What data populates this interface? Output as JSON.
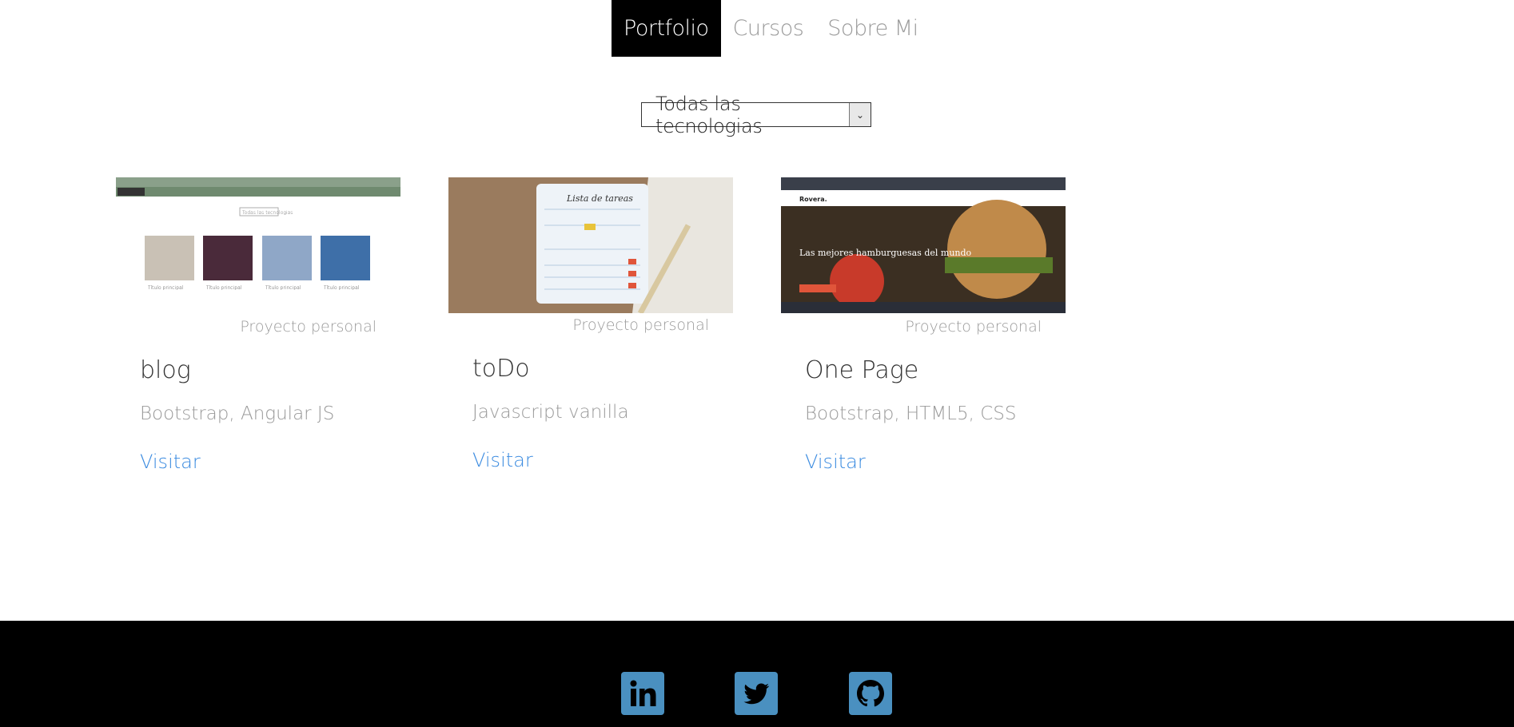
{
  "nav": {
    "items": [
      {
        "label": "Portfolio",
        "active": true
      },
      {
        "label": "Cursos",
        "active": false
      },
      {
        "label": "Sobre Mi",
        "active": false
      }
    ]
  },
  "filter": {
    "selected": "Todas las tecnologias"
  },
  "projects": [
    {
      "tag": "Proyecto personal",
      "title": "blog",
      "tech": "Bootstrap, Angular JS",
      "link": "Visitar"
    },
    {
      "tag": "Proyecto personal",
      "title": "toDo",
      "tech": "Javascript vanilla",
      "link": "Visitar"
    },
    {
      "tag": "Proyecto personal",
      "title": "One Page",
      "tech": "Bootstrap, HTML5, CSS",
      "link": "Visitar"
    }
  ],
  "thumb_text": {
    "blog_select": "Todas las tecnologias",
    "blog_card_title": "Título principal",
    "todo_heading": "Lista de tareas",
    "onepage_brand": "Rovera.",
    "onepage_headline": "Las mejores hamburguesas del mundo"
  },
  "footer": {
    "icons": [
      "linkedin-icon",
      "twitter-icon",
      "github-icon"
    ],
    "icon_color": "#4a90c0",
    "background": "#000000"
  },
  "colors": {
    "link": "#3b8be0",
    "muted": "#9a9a9a",
    "active_nav_bg": "#000000"
  }
}
